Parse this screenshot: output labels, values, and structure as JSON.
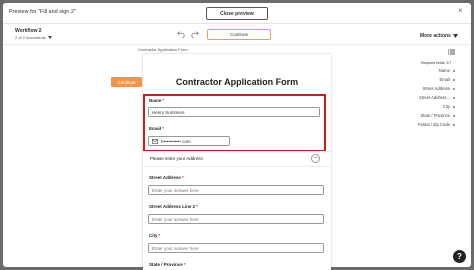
{
  "header": {
    "title": "Preview for \"Fill and sign 2\"",
    "close_preview_label": "Close preview",
    "close_icon": "×"
  },
  "toolbar": {
    "workflow_name": "Workflow 2",
    "documents_count": "2 of 2 documents",
    "continue_label": "Continue",
    "more_actions_label": "More actions"
  },
  "document": {
    "label": "Contractor Application Form",
    "side_continue_label": "Continue",
    "form_title": "Contractor Application Form",
    "name_label": "Name",
    "name_value": "Henry Summers",
    "email_label": "Email",
    "email_value": "h•••••••••••.com",
    "address_section_title": "Please enter your Address",
    "collapse_icon": "−",
    "street_label": "Street Address",
    "street_placeholder": "Enter your answer here",
    "street2_label": "Street Address Line 2",
    "street2_placeholder": "Enter your answer here",
    "city_label": "City",
    "city_placeholder": "Enter your answer here",
    "state_label": "State / Province",
    "required_marker": "*"
  },
  "right_panel": {
    "required_fields": "Required fields: 2/7",
    "items": [
      "Name",
      "Email",
      "Street Address",
      "Street Address...",
      "City",
      "State / Province",
      "Postal / Zip Code"
    ]
  },
  "help": {
    "label": "?"
  },
  "colors": {
    "accent_orange": "#f0954b",
    "highlight_red": "#c6201d",
    "required_red": "#d62b2b"
  }
}
